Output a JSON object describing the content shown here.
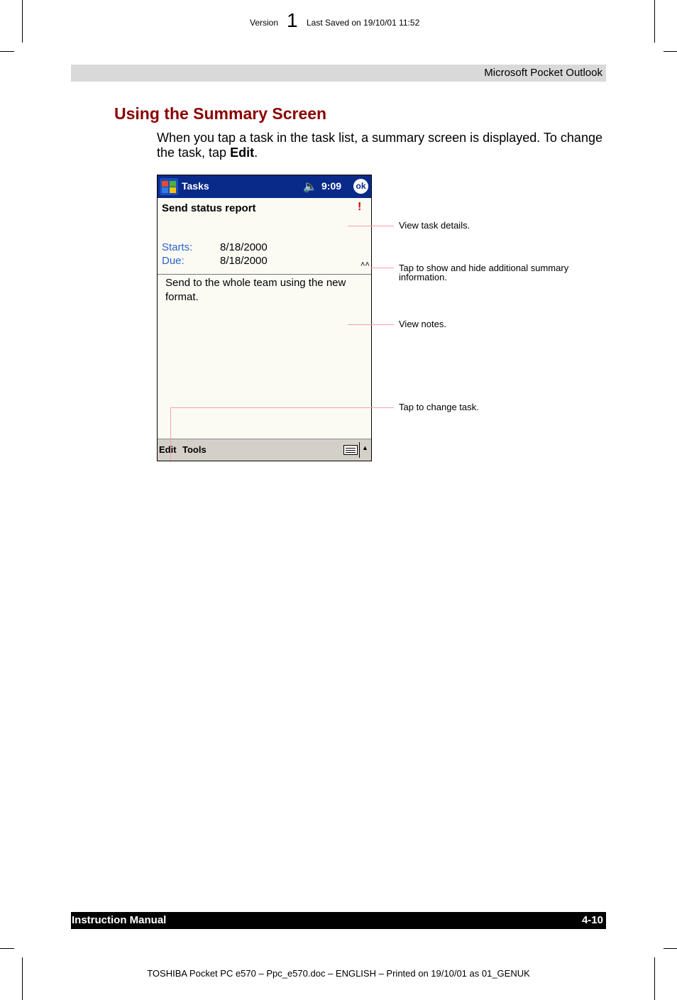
{
  "header": {
    "version_label": "Version",
    "version_number": "1",
    "last_saved": "Last Saved on 19/10/01 11:52",
    "section": "Microsoft Pocket Outlook"
  },
  "content": {
    "heading": "Using the Summary Screen",
    "para_before": "When you tap a task in the task list, a summary screen is displayed. To change the task, tap ",
    "para_bold": "Edit",
    "para_after": "."
  },
  "screenshot": {
    "app_title": "Tasks",
    "speaker_icon": "🔈",
    "time": "9:09",
    "ok_label": "ok",
    "subject": "Send status report",
    "priority_mark": "!",
    "starts_label": "Starts:",
    "starts_value": "8/18/2000",
    "due_label": "Due:",
    "due_value": "8/18/2000",
    "notes": "Send to the whole team using the new format.",
    "menu_edit": "Edit",
    "menu_tools": "Tools",
    "caret": "▲",
    "collapse_chevron": "˄˄",
    "colors": {
      "titlebar": "#0a2a8a",
      "date_labels": "#2a64c8",
      "priority": "#cc0000"
    }
  },
  "callouts": {
    "details": "View task details.",
    "toggle": "Tap to show and hide additional summary information.",
    "notes": "View notes.",
    "change": "Tap to change task."
  },
  "footer": {
    "manual": "Instruction Manual",
    "page": "4-10",
    "printed": "TOSHIBA Pocket PC e570  – Ppc_e570.doc – ENGLISH – Printed on 19/10/01 as 01_GENUK"
  },
  "colors": {
    "heading": "#8b0000",
    "callout_line": "#f4a0a8",
    "band": "#d9d9d9"
  }
}
